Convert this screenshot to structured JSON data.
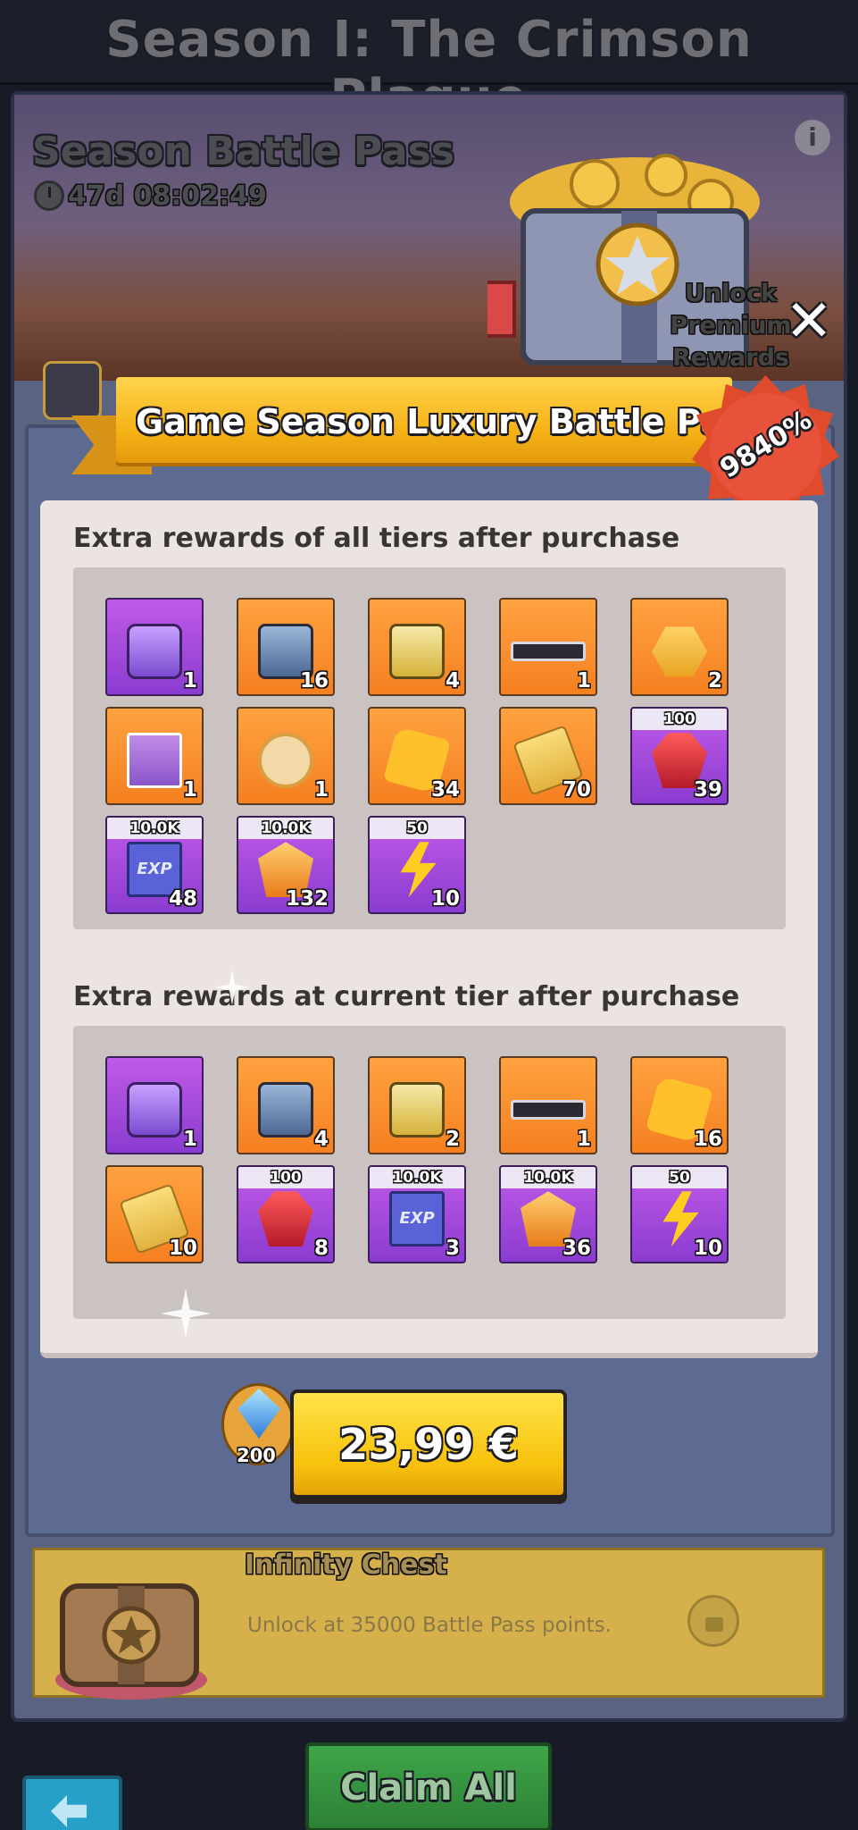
{
  "header": {
    "season_title": "Season I: The Crimson Plague"
  },
  "banner": {
    "title": "Season Battle Pass",
    "timer": "47d 08:02:49",
    "unlock_premium": "Unlock Premium Rewards"
  },
  "modal": {
    "title": "Game Season Luxury Battle Pass",
    "badge": "9840%",
    "section_all_tiers": "Extra rewards of all tiers after purchase",
    "section_current_tier": "Extra rewards at current tier after purchase",
    "all_tiers_items": [
      {
        "icon": "purple-crate-icon",
        "color": "purple",
        "count": "1",
        "top": ""
      },
      {
        "icon": "blue-chest-icon",
        "color": "orange",
        "count": "16",
        "top": ""
      },
      {
        "icon": "gold-chest-icon",
        "color": "orange",
        "count": "4",
        "top": ""
      },
      {
        "icon": "nameplate-bar-icon",
        "color": "orange",
        "count": "1",
        "top": ""
      },
      {
        "icon": "skill-badge-icon",
        "color": "orange",
        "count": "2",
        "top": ""
      },
      {
        "icon": "skill-book-refresh-icon",
        "color": "orange",
        "count": "1",
        "top": ""
      },
      {
        "icon": "hero-portrait-refresh-icon",
        "color": "orange",
        "count": "1",
        "top": ""
      },
      {
        "icon": "puzzle-piece-icon",
        "color": "orange",
        "count": "34",
        "top": ""
      },
      {
        "icon": "gold-tickets-icon",
        "color": "orange",
        "count": "70",
        "top": ""
      },
      {
        "icon": "ruby-icon",
        "color": "purple",
        "count": "39",
        "top": "100"
      },
      {
        "icon": "exp-book-icon",
        "color": "purple",
        "count": "48",
        "top": "10.0K"
      },
      {
        "icon": "amber-gem-icon",
        "color": "purple",
        "count": "132",
        "top": "10.0K"
      },
      {
        "icon": "lightning-bolt-icon",
        "color": "purple",
        "count": "10",
        "top": "50"
      }
    ],
    "current_tier_items": [
      {
        "icon": "purple-crate-icon",
        "color": "purple",
        "count": "1",
        "top": ""
      },
      {
        "icon": "blue-chest-icon",
        "color": "orange",
        "count": "4",
        "top": ""
      },
      {
        "icon": "gold-chest-icon",
        "color": "orange",
        "count": "2",
        "top": ""
      },
      {
        "icon": "nameplate-bar-icon",
        "color": "orange",
        "count": "1",
        "top": ""
      },
      {
        "icon": "puzzle-piece-icon",
        "color": "orange",
        "count": "16",
        "top": ""
      },
      {
        "icon": "gold-tickets-icon",
        "color": "orange",
        "count": "10",
        "top": ""
      },
      {
        "icon": "ruby-icon",
        "color": "purple",
        "count": "8",
        "top": "100"
      },
      {
        "icon": "exp-book-icon",
        "color": "purple",
        "count": "3",
        "top": "10.0K"
      },
      {
        "icon": "amber-gem-icon",
        "color": "purple",
        "count": "36",
        "top": "10.0K"
      },
      {
        "icon": "lightning-bolt-icon",
        "color": "purple",
        "count": "10",
        "top": "50"
      }
    ],
    "diamond_bonus": "200",
    "price": "23,99 €"
  },
  "infinity_chest": {
    "title": "Infinity Chest",
    "description": "Unlock at 35000 Battle Pass points."
  },
  "footer": {
    "claim_all": "Claim All"
  },
  "colors": {
    "accent_gold": "#f8c20c",
    "claim_green": "#3fa64a",
    "modal_blue": "#5d6b92"
  }
}
